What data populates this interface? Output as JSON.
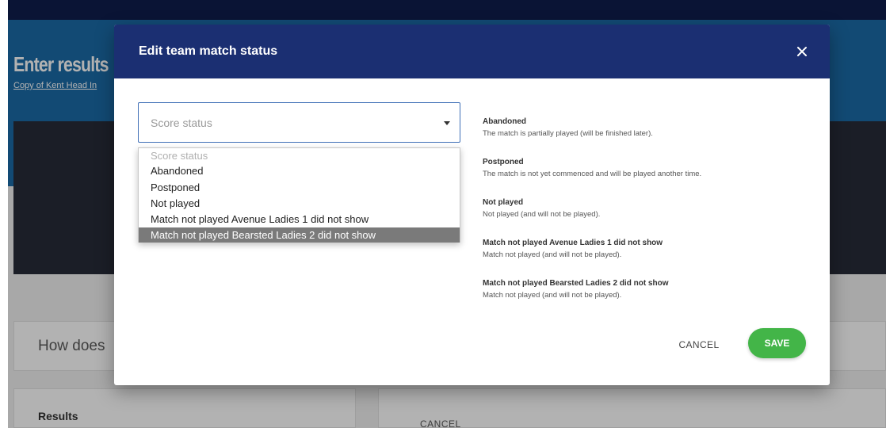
{
  "background": {
    "page_title": "Enter results",
    "page_subtitle": "Copy of Kent Head In",
    "card_text": "How does",
    "results_label": "Results",
    "cancel_label": "CANCEL"
  },
  "modal": {
    "title": "Edit team match status",
    "close_icon": "close-icon",
    "select": {
      "value": "Score status"
    },
    "options": [
      {
        "label": "Score status",
        "placeholder": true
      },
      {
        "label": "Abandoned"
      },
      {
        "label": "Postponed"
      },
      {
        "label": "Not played"
      },
      {
        "label": "Match not played Avenue Ladies 1 did not show"
      },
      {
        "label": "Match not played Bearsted Ladies 2 did not show",
        "selected": true
      }
    ],
    "descriptions": [
      {
        "title": "Abandoned",
        "text": "The match is partially played (will be finished later)."
      },
      {
        "title": "Postponed",
        "text": "The match is not yet commenced and will be played another time."
      },
      {
        "title": "Not played",
        "text": "Not played (and will not be played)."
      },
      {
        "title": "Match not played Avenue Ladies 1 did not show",
        "text": "Match not played (and will not be played)."
      },
      {
        "title": "Match not played Bearsted Ladies 2 did not show",
        "text": "Match not played (and will not be played)."
      }
    ],
    "cancel_label": "CANCEL",
    "save_label": "SAVE"
  },
  "colors": {
    "header_bg": "#1b2f72",
    "hero_bg": "#1a6aa6",
    "save_green": "#43b548",
    "selected_option": "#7a7a7a"
  }
}
